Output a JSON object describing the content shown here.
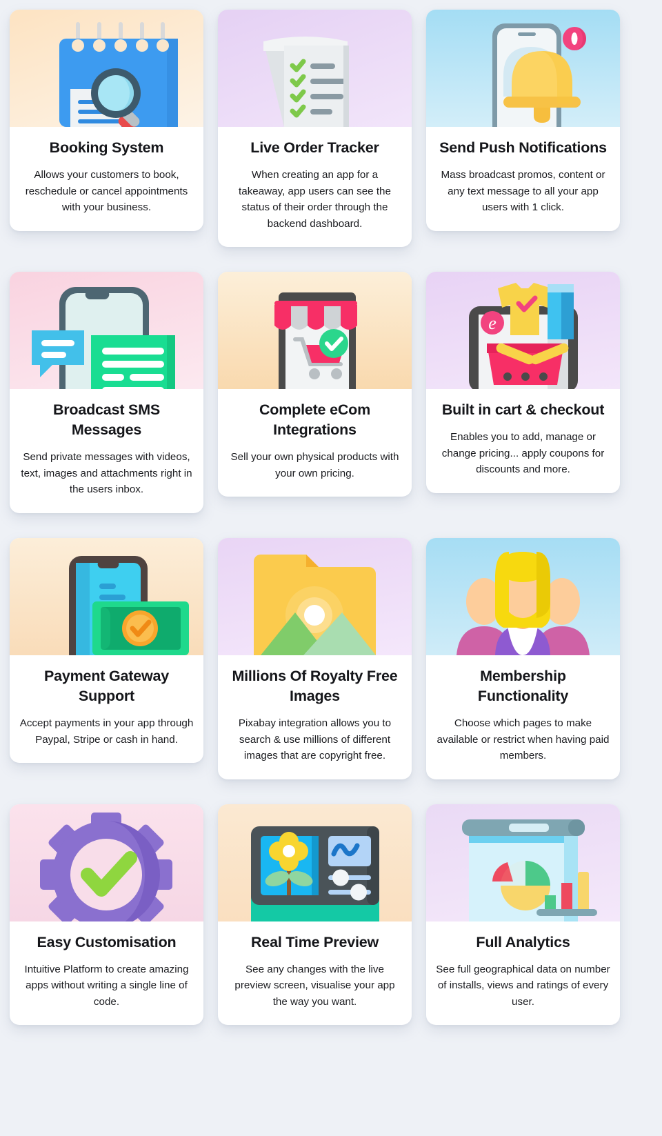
{
  "page": {
    "background_color": "#eef1f6",
    "card_background": "#ffffff",
    "columns": 3
  },
  "cards": [
    {
      "icon": "calendar-search-icon",
      "title": "Booking System",
      "description": "Allows your customers to book, reschedule or cancel appointments with your business.",
      "media_gradient_from": "#fde8cf",
      "media_gradient_to": "#fbf2e6"
    },
    {
      "icon": "receipt-checklist-icon",
      "title": "Live Order Tracker",
      "description": "When creating an app for a takeaway, app users can see the status of their order through the backend dashboard.",
      "media_gradient_from": "#e7d4f5",
      "media_gradient_to": "#f0e2f9"
    },
    {
      "icon": "phone-bell-notification-icon",
      "title": "Send Push Notifications",
      "description": "Mass broadcast promos, content or any text message to all your app users with 1 click.",
      "media_gradient_from": "#a9dff5",
      "media_gradient_to": "#cfecf9"
    },
    {
      "icon": "phone-chat-bubbles-icon",
      "title": "Broadcast SMS Messages",
      "description": "Send private messages with videos, text, images and attachments right in the users inbox.",
      "media_gradient_from": "#fad7e1",
      "media_gradient_to": "#fbe7ee"
    },
    {
      "icon": "storefront-cart-icon",
      "title": "Complete eCom Integrations",
      "description": "Sell your own physical products with your own pricing.",
      "media_gradient_from": "#fbeed8",
      "media_gradient_to": "#fadcb8"
    },
    {
      "icon": "shopping-basket-clothes-icon",
      "title": "Built in cart & checkout",
      "description": "Enables you to add, manage or change pricing... apply coupons for discounts and more.",
      "media_gradient_from": "#ead6f5",
      "media_gradient_to": "#f1e3f9"
    },
    {
      "icon": "phone-money-icon",
      "title": "Payment Gateway Support",
      "description": "Accept payments in your app through Paypal, Stripe or cash in hand.",
      "media_gradient_from": "#fbecd8",
      "media_gradient_to": "#f9dcba"
    },
    {
      "icon": "image-folder-icon",
      "title": "Millions Of Royalty Free Images",
      "description": "Pixabay integration allows you to search & use millions of different images that are copyright free.",
      "media_gradient_from": "#ebd8f6",
      "media_gradient_to": "#f2e4fa"
    },
    {
      "icon": "people-group-icon",
      "title": "Membership Functionality",
      "description": "Choose which pages to make available or restrict when having paid members.",
      "media_gradient_from": "#aadff4",
      "media_gradient_to": "#cdeaf8"
    },
    {
      "icon": "gear-check-icon",
      "title": "Easy Customisation",
      "description": "Intuitive Platform to create amazing apps without writing a single line of code.",
      "media_gradient_from": "#fadfe9",
      "media_gradient_to": "#f7d9e6"
    },
    {
      "icon": "preview-screen-icon",
      "title": "Real Time Preview",
      "description": "See any changes with the live preview screen, visualise your app the way you want.",
      "media_gradient_from": "#fbe7d0",
      "media_gradient_to": "#fbdfc0"
    },
    {
      "icon": "analytics-charts-icon",
      "title": "Full Analytics",
      "description": "See full geographical data on number of installs, views and ratings of every user.",
      "media_gradient_from": "#ecd8f5",
      "media_gradient_to": "#f3e5fa"
    }
  ]
}
